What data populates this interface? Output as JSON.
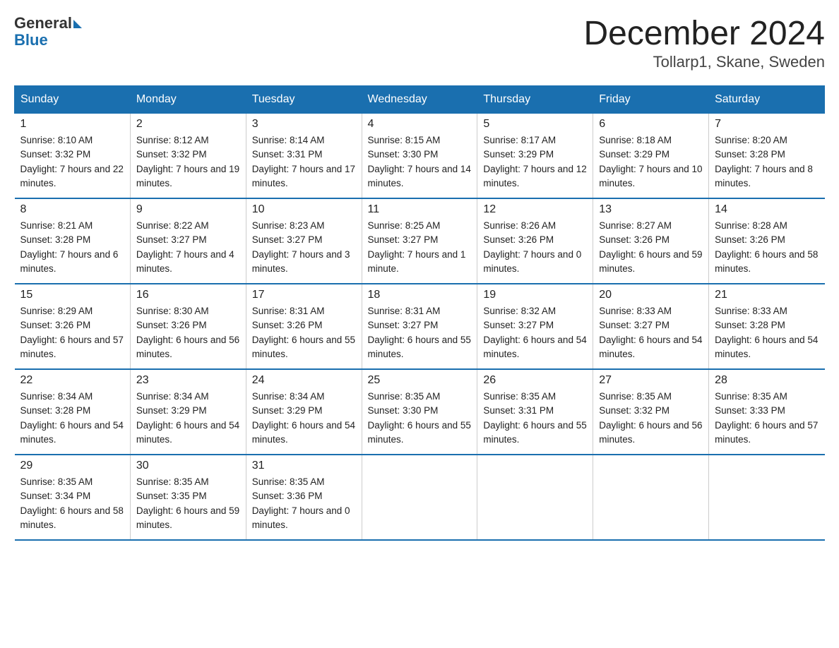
{
  "header": {
    "logo_general": "General",
    "logo_blue": "Blue",
    "month_title": "December 2024",
    "location": "Tollarp1, Skane, Sweden"
  },
  "days_of_week": [
    "Sunday",
    "Monday",
    "Tuesday",
    "Wednesday",
    "Thursday",
    "Friday",
    "Saturday"
  ],
  "weeks": [
    [
      {
        "day": "1",
        "sunrise": "8:10 AM",
        "sunset": "3:32 PM",
        "daylight": "7 hours and 22 minutes."
      },
      {
        "day": "2",
        "sunrise": "8:12 AM",
        "sunset": "3:32 PM",
        "daylight": "7 hours and 19 minutes."
      },
      {
        "day": "3",
        "sunrise": "8:14 AM",
        "sunset": "3:31 PM",
        "daylight": "7 hours and 17 minutes."
      },
      {
        "day": "4",
        "sunrise": "8:15 AM",
        "sunset": "3:30 PM",
        "daylight": "7 hours and 14 minutes."
      },
      {
        "day": "5",
        "sunrise": "8:17 AM",
        "sunset": "3:29 PM",
        "daylight": "7 hours and 12 minutes."
      },
      {
        "day": "6",
        "sunrise": "8:18 AM",
        "sunset": "3:29 PM",
        "daylight": "7 hours and 10 minutes."
      },
      {
        "day": "7",
        "sunrise": "8:20 AM",
        "sunset": "3:28 PM",
        "daylight": "7 hours and 8 minutes."
      }
    ],
    [
      {
        "day": "8",
        "sunrise": "8:21 AM",
        "sunset": "3:28 PM",
        "daylight": "7 hours and 6 minutes."
      },
      {
        "day": "9",
        "sunrise": "8:22 AM",
        "sunset": "3:27 PM",
        "daylight": "7 hours and 4 minutes."
      },
      {
        "day": "10",
        "sunrise": "8:23 AM",
        "sunset": "3:27 PM",
        "daylight": "7 hours and 3 minutes."
      },
      {
        "day": "11",
        "sunrise": "8:25 AM",
        "sunset": "3:27 PM",
        "daylight": "7 hours and 1 minute."
      },
      {
        "day": "12",
        "sunrise": "8:26 AM",
        "sunset": "3:26 PM",
        "daylight": "7 hours and 0 minutes."
      },
      {
        "day": "13",
        "sunrise": "8:27 AM",
        "sunset": "3:26 PM",
        "daylight": "6 hours and 59 minutes."
      },
      {
        "day": "14",
        "sunrise": "8:28 AM",
        "sunset": "3:26 PM",
        "daylight": "6 hours and 58 minutes."
      }
    ],
    [
      {
        "day": "15",
        "sunrise": "8:29 AM",
        "sunset": "3:26 PM",
        "daylight": "6 hours and 57 minutes."
      },
      {
        "day": "16",
        "sunrise": "8:30 AM",
        "sunset": "3:26 PM",
        "daylight": "6 hours and 56 minutes."
      },
      {
        "day": "17",
        "sunrise": "8:31 AM",
        "sunset": "3:26 PM",
        "daylight": "6 hours and 55 minutes."
      },
      {
        "day": "18",
        "sunrise": "8:31 AM",
        "sunset": "3:27 PM",
        "daylight": "6 hours and 55 minutes."
      },
      {
        "day": "19",
        "sunrise": "8:32 AM",
        "sunset": "3:27 PM",
        "daylight": "6 hours and 54 minutes."
      },
      {
        "day": "20",
        "sunrise": "8:33 AM",
        "sunset": "3:27 PM",
        "daylight": "6 hours and 54 minutes."
      },
      {
        "day": "21",
        "sunrise": "8:33 AM",
        "sunset": "3:28 PM",
        "daylight": "6 hours and 54 minutes."
      }
    ],
    [
      {
        "day": "22",
        "sunrise": "8:34 AM",
        "sunset": "3:28 PM",
        "daylight": "6 hours and 54 minutes."
      },
      {
        "day": "23",
        "sunrise": "8:34 AM",
        "sunset": "3:29 PM",
        "daylight": "6 hours and 54 minutes."
      },
      {
        "day": "24",
        "sunrise": "8:34 AM",
        "sunset": "3:29 PM",
        "daylight": "6 hours and 54 minutes."
      },
      {
        "day": "25",
        "sunrise": "8:35 AM",
        "sunset": "3:30 PM",
        "daylight": "6 hours and 55 minutes."
      },
      {
        "day": "26",
        "sunrise": "8:35 AM",
        "sunset": "3:31 PM",
        "daylight": "6 hours and 55 minutes."
      },
      {
        "day": "27",
        "sunrise": "8:35 AM",
        "sunset": "3:32 PM",
        "daylight": "6 hours and 56 minutes."
      },
      {
        "day": "28",
        "sunrise": "8:35 AM",
        "sunset": "3:33 PM",
        "daylight": "6 hours and 57 minutes."
      }
    ],
    [
      {
        "day": "29",
        "sunrise": "8:35 AM",
        "sunset": "3:34 PM",
        "daylight": "6 hours and 58 minutes."
      },
      {
        "day": "30",
        "sunrise": "8:35 AM",
        "sunset": "3:35 PM",
        "daylight": "6 hours and 59 minutes."
      },
      {
        "day": "31",
        "sunrise": "8:35 AM",
        "sunset": "3:36 PM",
        "daylight": "7 hours and 0 minutes."
      },
      null,
      null,
      null,
      null
    ]
  ]
}
